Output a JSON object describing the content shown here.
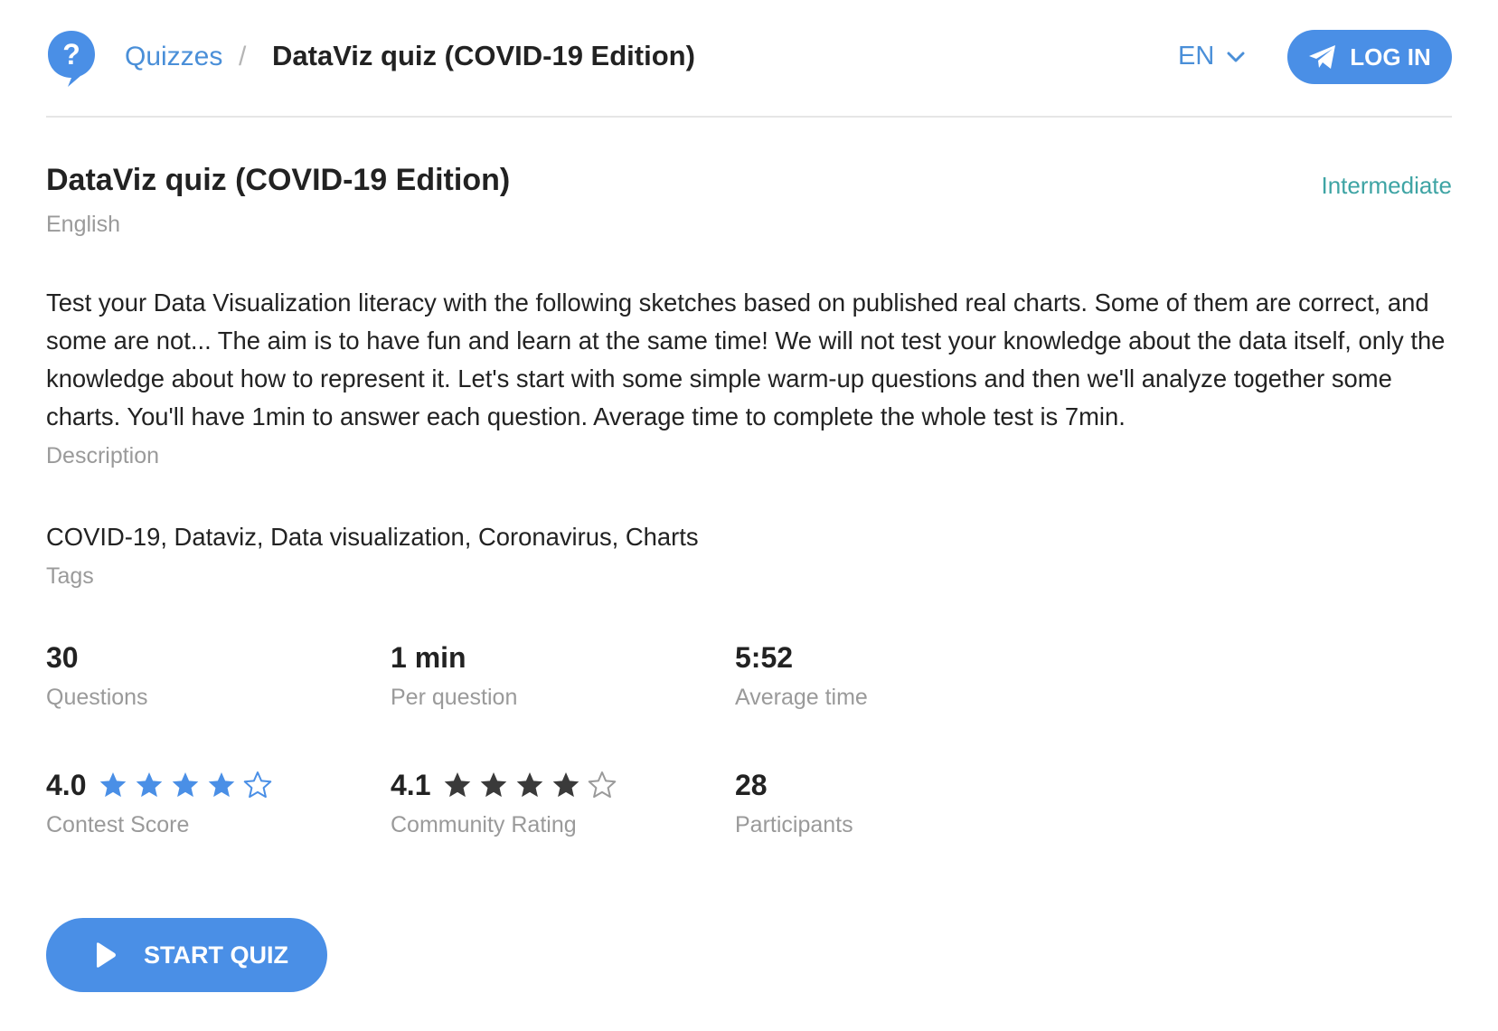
{
  "header": {
    "breadcrumb_root": "Quizzes",
    "breadcrumb_separator": "/",
    "breadcrumb_current": "DataViz quiz (COVID-19 Edition)",
    "language": "EN",
    "login_label": "LOG IN",
    "logo_glyph": "?"
  },
  "quiz": {
    "title": "DataViz quiz (COVID-19 Edition)",
    "language": "English",
    "level": "Intermediate",
    "description": "Test your Data Visualization literacy with the following sketches based on published real charts. Some of them are correct, and some are not... The aim is to have fun and learn at the same time! We will not test your knowledge about the data itself, only the knowledge about how to represent it. Let's start with some simple warm-up questions and then we'll analyze together some charts. You'll have 1min to answer each question. Average time to complete the whole test is 7min.",
    "description_label": "Description",
    "tags": "COVID-19, Dataviz, Data visualization, Coronavirus, Charts",
    "tags_label": "Tags"
  },
  "stats": {
    "questions": {
      "value": "30",
      "label": "Questions"
    },
    "per_question": {
      "value": "1 min",
      "label": "Per question"
    },
    "average_time": {
      "value": "5:52",
      "label": "Average time"
    },
    "contest_score": {
      "value": "4.0",
      "label": "Contest Score",
      "filled_stars": 4,
      "total_stars": 5
    },
    "community_rating": {
      "value": "4.1",
      "label": "Community Rating",
      "filled_stars": 4,
      "total_stars": 5
    },
    "participants": {
      "value": "28",
      "label": "Participants"
    }
  },
  "actions": {
    "start_label": "START QUIZ"
  },
  "colors": {
    "accent": "#4a8fe6",
    "link": "#4a8fd8",
    "level": "#3ea4a4",
    "muted": "#9a9a9a",
    "dark_star": "#3a3a3a",
    "text": "#222222"
  },
  "icons": {
    "logo": "question-bubble-icon",
    "language_toggle": "chevron-down-icon",
    "login": "telegram-send-icon",
    "start": "play-icon",
    "rating": "star-icon"
  }
}
